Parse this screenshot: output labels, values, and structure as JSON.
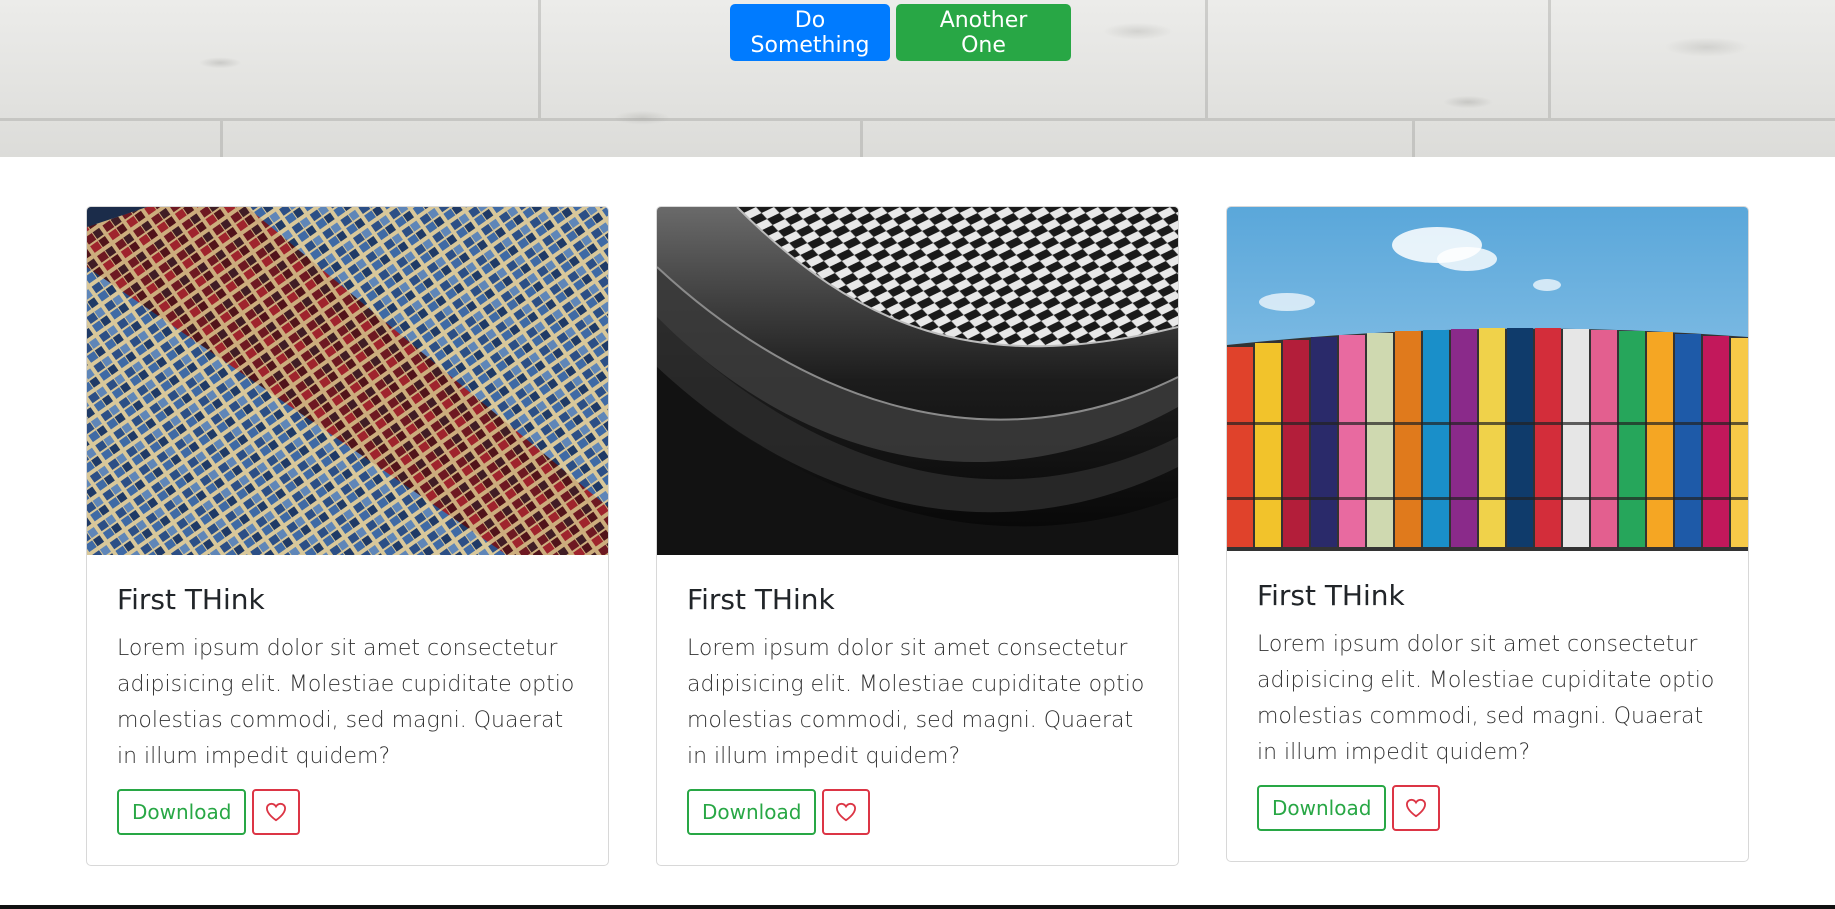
{
  "hero": {
    "buttons": [
      {
        "label": "Do Something",
        "color": "#007bff"
      },
      {
        "label": "Another One",
        "color": "#28a745"
      }
    ]
  },
  "cards": [
    {
      "image": "glass-building-facade-photo",
      "title": "First THink",
      "text": "Lorem ipsum dolor sit amet consectetur adipisicing elit. Molestiae cupiditate optio molestias commodi, sed magni. Quaerat in illum impedit quidem?",
      "download_label": "Download",
      "favorite_icon": "heart-icon"
    },
    {
      "image": "black-white-architecture-photo",
      "title": "First THink",
      "text": "Lorem ipsum dolor sit amet consectetur adipisicing elit. Molestiae cupiditate optio molestias commodi, sed magni. Quaerat in illum impedit quidem?",
      "download_label": "Download",
      "favorite_icon": "heart-icon"
    },
    {
      "image": "colorful-building-photo",
      "title": "First THink",
      "text": "Lorem ipsum dolor sit amet consectetur adipisicing elit. Molestiae cupiditate optio molestias commodi, sed magni. Quaerat in illum impedit quidem?",
      "download_label": "Download",
      "favorite_icon": "heart-icon"
    }
  ],
  "colors": {
    "success": "#28a745",
    "danger": "#dc3545",
    "primary": "#007bff"
  }
}
